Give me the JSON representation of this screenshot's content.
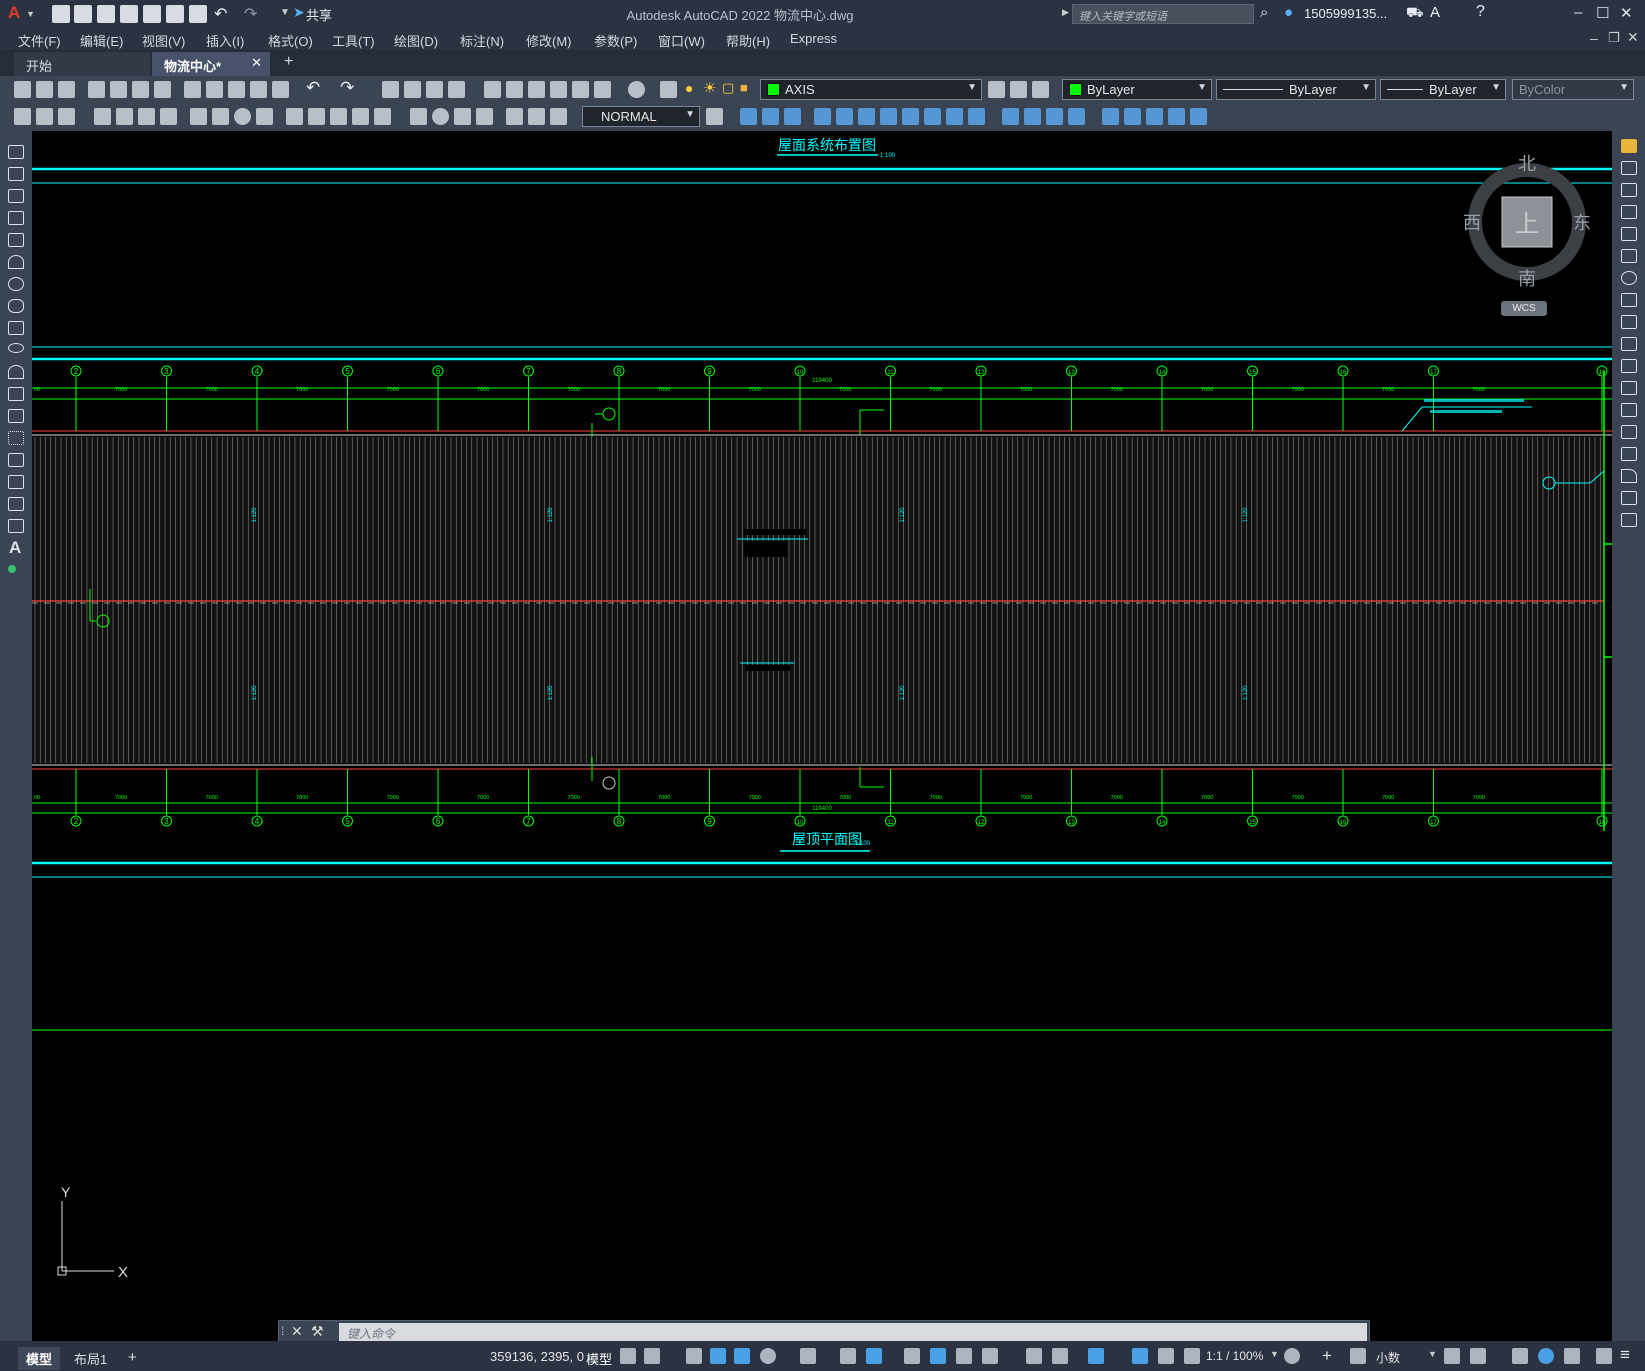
{
  "app": {
    "title": "Autodesk AutoCAD 2022    物流中心.dwg",
    "share_label": "共享",
    "search_placeholder": "键入关键字或短语",
    "user": "1505999135...",
    "logo": "A"
  },
  "menubar": [
    "文件(F)",
    "编辑(E)",
    "视图(V)",
    "插入(I)",
    "格式(O)",
    "工具(T)",
    "绘图(D)",
    "标注(N)",
    "修改(M)",
    "参数(P)",
    "窗口(W)",
    "帮助(H)",
    "Express"
  ],
  "file_tabs": {
    "start": "开始",
    "document": "物流中心*",
    "add": "+"
  },
  "properties": {
    "layer": "AXIS",
    "color": "ByLayer",
    "linetype": "ByLayer",
    "lineweight": "ByLayer",
    "plotstyle": "ByColor",
    "textstyle": "NORMAL",
    "layer_color": "#00ff00"
  },
  "drawing": {
    "top_title": "屋面系统布置图",
    "top_title_scale": "1:100",
    "bottom_title": "屋顶平面图",
    "bottom_title_scale": "1:100",
    "axis_labels": [
      "2",
      "3",
      "4",
      "5",
      "6",
      "7",
      "8",
      "9",
      "10",
      "11",
      "12",
      "13",
      "14",
      "15",
      "16",
      "17",
      "18"
    ],
    "span_dimension": "7000",
    "total_dimension": "119400",
    "edge_dimension": "00",
    "marker_text": "1:120",
    "colors": {
      "grid": "#00ff00",
      "title": "#00ffff",
      "ridge": "#ff4040",
      "panels": "#d0d0d0"
    }
  },
  "viewcube": {
    "north": "北",
    "south": "南",
    "west": "西",
    "east": "东",
    "face": "上",
    "wcs": "WCS"
  },
  "ucs": {
    "x": "X",
    "y": "Y"
  },
  "command": {
    "placeholder": "键入命令"
  },
  "status": {
    "model_tab": "模型",
    "layout_tab": "布局1",
    "add_tab": "+",
    "coords": "359136, 2395, 0",
    "model_label": "模型",
    "scale": "1:1 / 100%",
    "units": "小数"
  }
}
